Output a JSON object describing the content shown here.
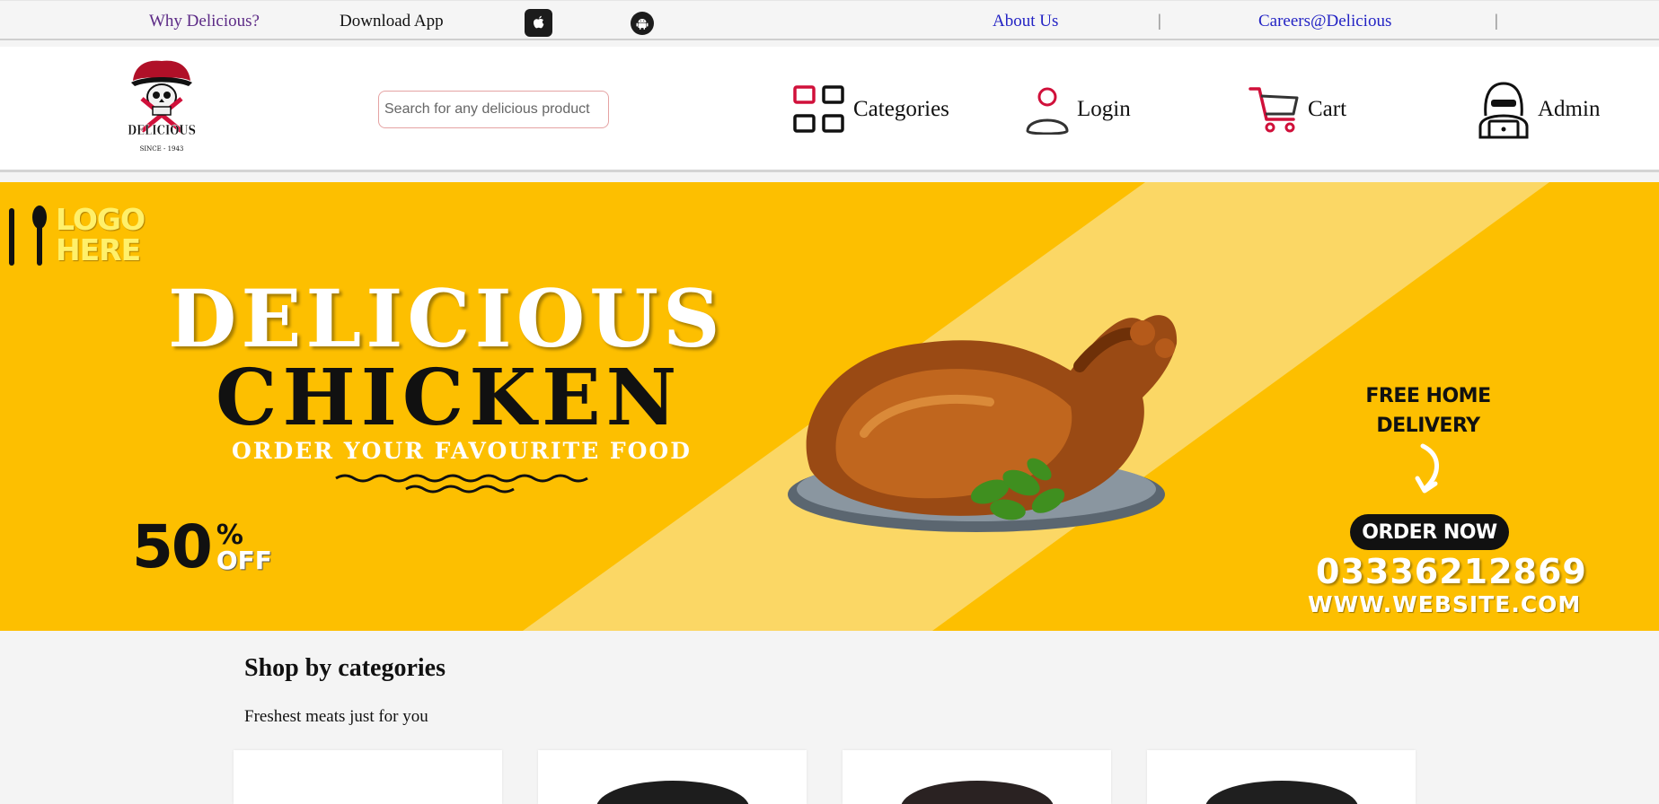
{
  "topbar": {
    "why_label": "Why Delicious?",
    "download_label": "Download App",
    "about_label": "About Us",
    "careers_label": "Careers@Delicious",
    "separator": "|"
  },
  "header": {
    "logo_text": "DELICIOUS",
    "logo_since": "SINCE - 1943",
    "search_placeholder": "Search for any delicious product",
    "nav": {
      "categories": "Categories",
      "login": "Login",
      "cart": "Cart",
      "admin": "Admin"
    }
  },
  "banner": {
    "logo_text": "LOGO\nHERE",
    "headline_1": "DELICIOUS",
    "headline_2": "CHICKEN",
    "tagline": "ORDER YOUR FAVOURITE FOOD",
    "discount_number": "50",
    "discount_percent": "%",
    "discount_off": "OFF",
    "delivery": "FREE HOME DELIVERY",
    "order_button": "ORDER NOW",
    "phone": "03336212869",
    "website": "WWW.WEBSITE.COM"
  },
  "section": {
    "title": "Shop by categories",
    "subtitle": "Freshest meats just for you"
  },
  "colors": {
    "accent_red": "#d0103a",
    "banner_yellow": "#fdbf00",
    "link_blue": "#2323c4"
  }
}
